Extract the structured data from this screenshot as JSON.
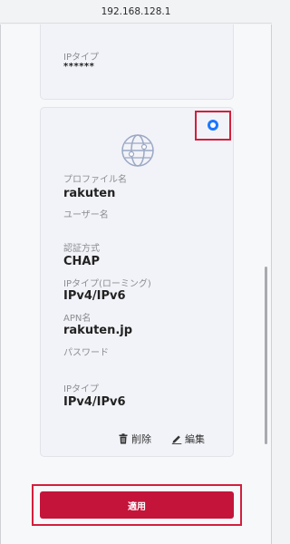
{
  "browser": {
    "url": "192.168.128.1"
  },
  "top_card": {
    "ip_type_label": "IPタイプ",
    "password_mask": "******"
  },
  "profile_card": {
    "selected": true,
    "profile_name_label": "プロファイル名",
    "profile_name": "rakuten",
    "username_label": "ユーザー名",
    "username": "",
    "auth_label": "認証方式",
    "auth": "CHAP",
    "ip_roaming_label": "IPタイプ(ローミング)",
    "ip_roaming": "IPv4/IPv6",
    "apn_label": "APN名",
    "apn": "rakuten.jp",
    "password_label": "パスワード",
    "password": "",
    "ip_type_label": "IPタイプ",
    "ip_type": "IPv4/IPv6",
    "delete_label": "削除",
    "edit_label": "編集"
  },
  "apply_button": {
    "label": "適用"
  },
  "colors": {
    "accent_red": "#c4143a",
    "highlight_red": "#d21f3c",
    "radio_blue": "#1a78ff",
    "card_bg": "#f2f3f8"
  },
  "icons": {
    "profile": "globe-icon",
    "delete": "trash-icon",
    "edit": "pencil-icon"
  }
}
